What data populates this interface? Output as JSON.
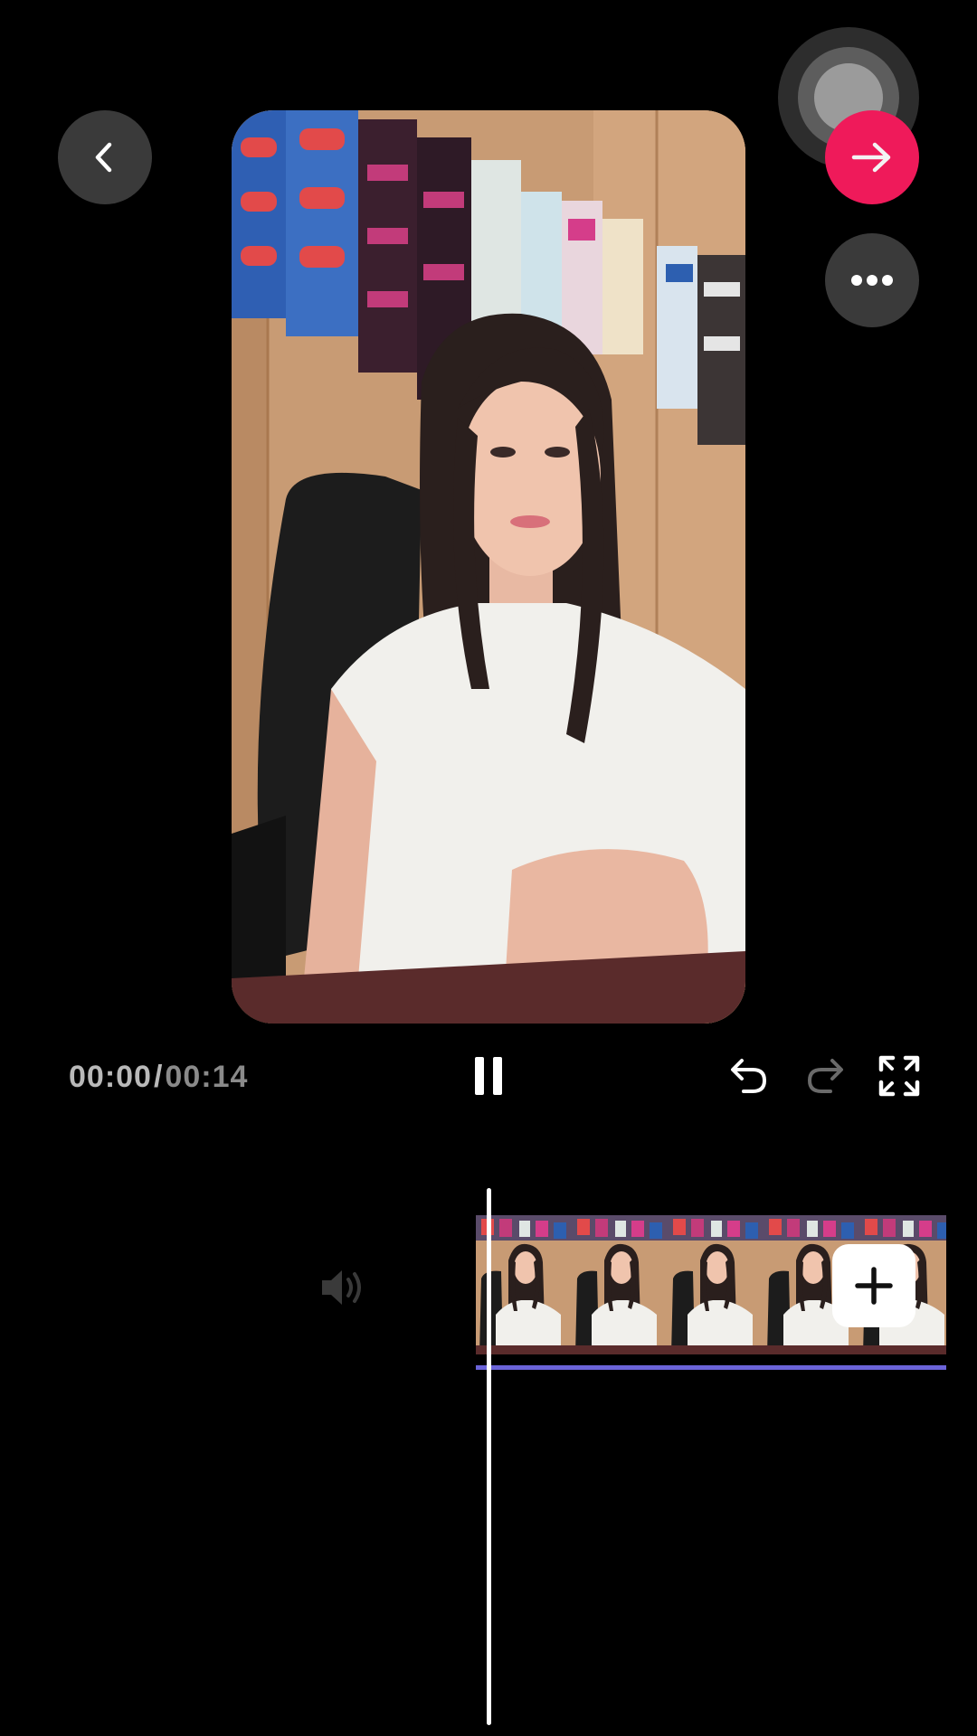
{
  "player": {
    "current_time": "00:00",
    "separator": "/",
    "duration": "00:14"
  },
  "icons": {
    "back": "chevron-left-icon",
    "next": "arrow-right-icon",
    "more": "ellipsis-icon",
    "pause": "pause-icon",
    "undo": "undo-icon",
    "redo": "redo-icon",
    "fullscreen": "fullscreen-icon",
    "volume": "volume-icon",
    "add_clip": "plus-icon",
    "assistive_touch": "assistive-touch-icon"
  },
  "colors": {
    "accent_next": "#ef1a5a",
    "timeline_underline": "#6b64d9",
    "button_dark": "#3a3a3a",
    "time_current": "#b9b9b9",
    "time_total": "#8a8a8a"
  },
  "timeline": {
    "thumbnail_count": 5
  }
}
